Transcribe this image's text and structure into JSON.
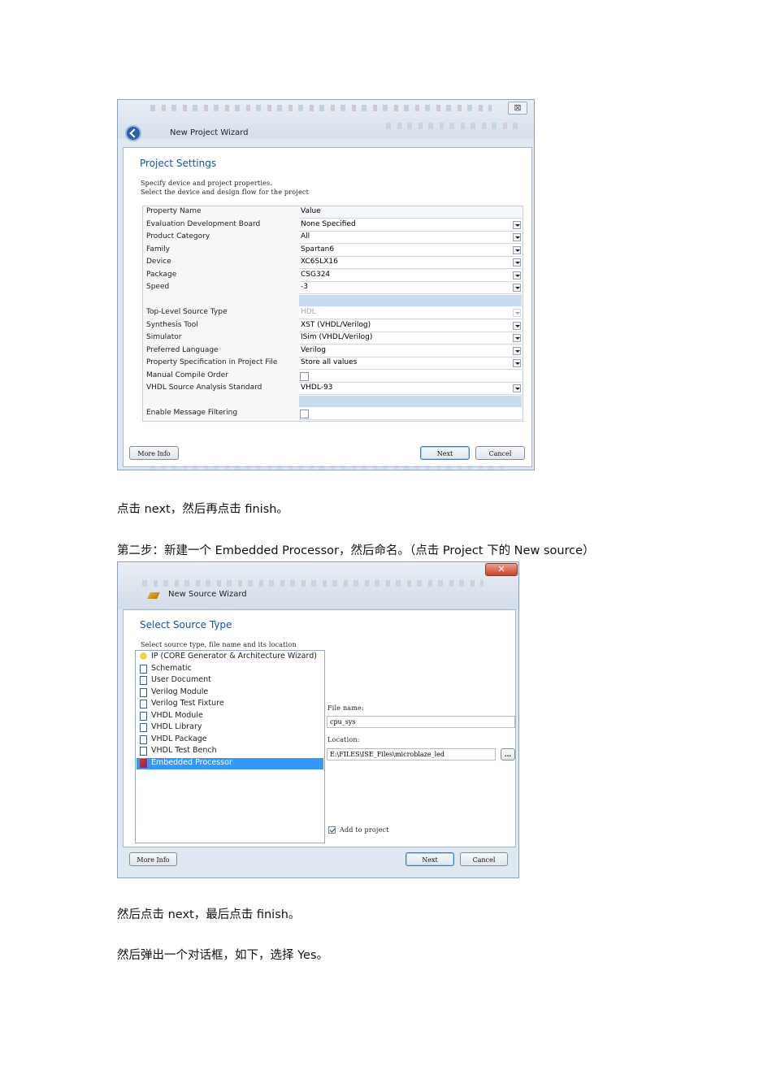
{
  "shot1": {
    "window_title": "New Project Wizard",
    "close_glyph": "⊠",
    "section_title": "Project Settings",
    "desc_line1": "Specify device and project properties.",
    "desc_line2": "Select the device and design flow for the project",
    "header": {
      "name": "Property Name",
      "value": "Value"
    },
    "rows": [
      {
        "name": "Evaluation Development Board",
        "value": "None Specified"
      },
      {
        "name": "Product Category",
        "value": "All"
      },
      {
        "name": "Family",
        "value": "Spartan6"
      },
      {
        "name": "Device",
        "value": "XC6SLX16"
      },
      {
        "name": "Package",
        "value": "CSG324"
      },
      {
        "name": "Speed",
        "value": "-3"
      },
      {
        "name": "Top-Level Source Type",
        "value": "HDL"
      },
      {
        "name": "Synthesis Tool",
        "value": "XST (VHDL/Verilog)"
      },
      {
        "name": "Simulator",
        "value": "ISim (VHDL/Verilog)"
      },
      {
        "name": "Preferred Language",
        "value": "Verilog"
      },
      {
        "name": "Property Specification in Project File",
        "value": "Store all values"
      },
      {
        "name": "Manual Compile Order",
        "value": ""
      },
      {
        "name": "VHDL Source Analysis Standard",
        "value": "VHDL-93"
      },
      {
        "name": "Enable Message Filtering",
        "value": ""
      }
    ],
    "buttons": {
      "more_info": "More Info",
      "next": "Next",
      "cancel": "Cancel"
    }
  },
  "caption1": "点击 next，然后再点击 finish。",
  "caption2": "第二步：新建一个 Embedded Processor，然后命名。（点击 Project 下的 New source）",
  "shot2": {
    "window_title": "New Source Wizard",
    "close_glyph": "✕",
    "section_title": "Select Source Type",
    "desc": "Select source type, file name and its location",
    "source_types": [
      "IP (CORE Generator & Architecture Wizard)",
      "Schematic",
      "User Document",
      "Verilog Module",
      "Verilog Test Fixture",
      "VHDL Module",
      "VHDL Library",
      "VHDL Package",
      "VHDL Test Bench",
      "Embedded Processor"
    ],
    "selected": "Embedded Processor",
    "file_name_label": "File name:",
    "file_name": "cpu_sys",
    "location_label": "Location:",
    "location": "E:\\FILES\\ISE_Files\\microblaze_led",
    "browse": "...",
    "add_to_project": "Add to project",
    "buttons": {
      "more_info": "More Info",
      "next": "Next",
      "cancel": "Cancel"
    }
  },
  "caption3": "然后点击 next，最后点击 finish。",
  "caption4": "然后弹出一个对话框，如下，选择 Yes。"
}
